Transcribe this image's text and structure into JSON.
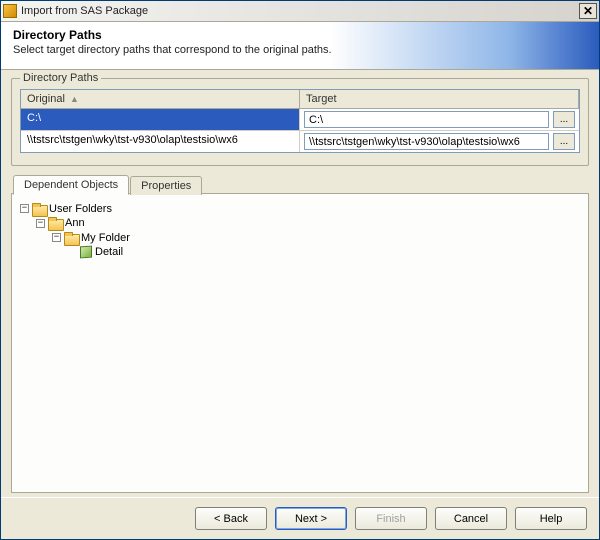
{
  "window": {
    "title": "Import from SAS Package"
  },
  "header": {
    "title": "Directory Paths",
    "subtitle": "Select target directory paths that correspond to the original paths."
  },
  "directory_paths": {
    "legend": "Directory Paths",
    "columns": {
      "original": "Original",
      "target": "Target"
    },
    "rows": [
      {
        "original": "C:\\",
        "target": "C:\\",
        "selected": true
      },
      {
        "original": "\\\\tstsrc\\tstgen\\wky\\tst-v930\\olap\\testsio\\wx6",
        "target": "\\\\tstsrc\\tstgen\\wky\\tst-v930\\olap\\testsio\\wx6",
        "selected": false
      }
    ]
  },
  "tabs": {
    "dependent": "Dependent Objects",
    "properties": "Properties",
    "active": "dependent"
  },
  "tree": {
    "root": "User Folders",
    "level1": "Ann",
    "level2": "My Folder",
    "leaf": "Detail"
  },
  "buttons": {
    "back": "< Back",
    "next": "Next >",
    "finish": "Finish",
    "cancel": "Cancel",
    "help": "Help"
  },
  "icons": {
    "browse": "..."
  }
}
